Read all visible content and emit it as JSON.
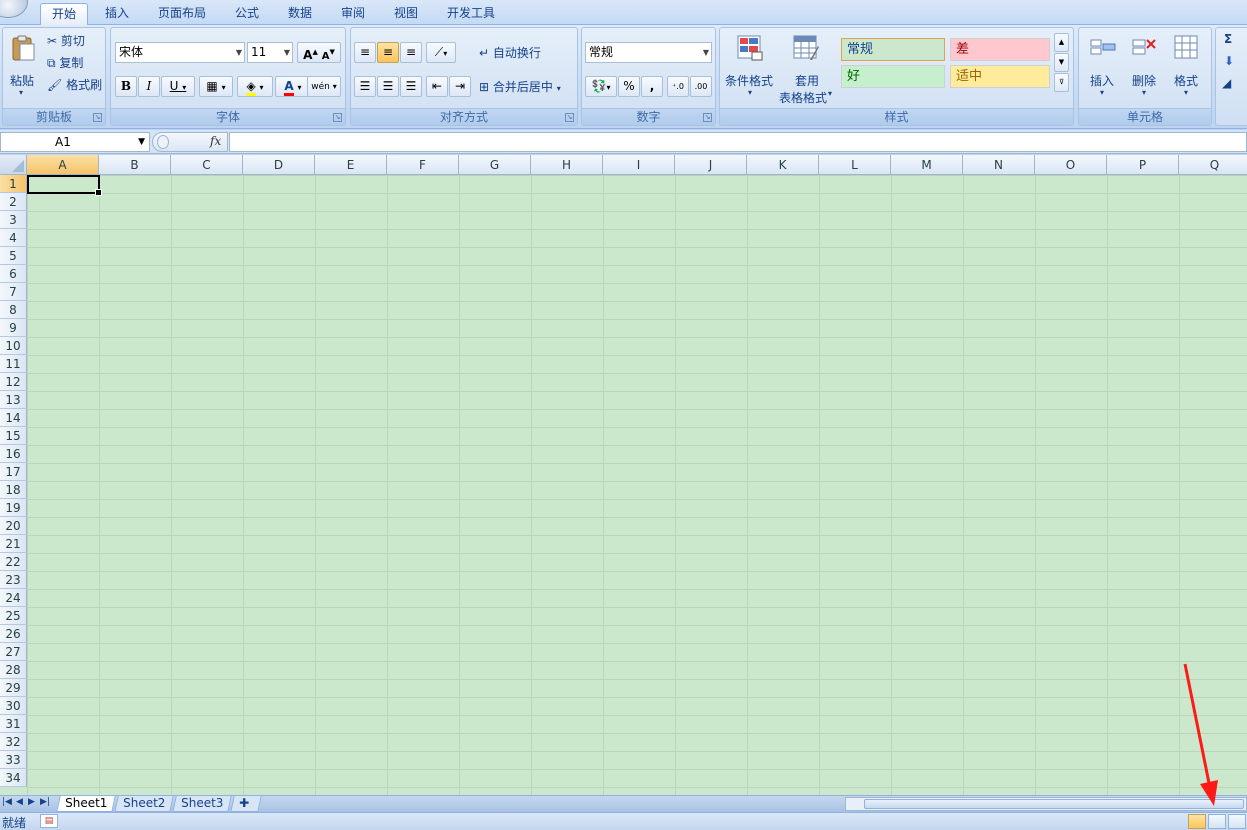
{
  "tabs": [
    "开始",
    "插入",
    "页面布局",
    "公式",
    "数据",
    "审阅",
    "视图",
    "开发工具"
  ],
  "clipboard": {
    "paste": "粘贴",
    "cut": "剪切",
    "copy": "复制",
    "format_painter": "格式刷",
    "label": "剪贴板"
  },
  "font": {
    "name": "宋体",
    "size": "11",
    "label": "字体",
    "bold": "B",
    "italic": "I",
    "underline": "U",
    "grow": "A",
    "shrink": "A",
    "color_letter": "A",
    "phonetic": "wén"
  },
  "alignment": {
    "wrap": "自动换行",
    "merge": "合并后居中",
    "label": "对齐方式"
  },
  "number": {
    "format": "常规",
    "percent": "%",
    "comma": ",",
    "label": "数字"
  },
  "styles": {
    "conditional": "条件格式",
    "table_line1": "套用",
    "table_line2": "表格格式",
    "normal": "常规",
    "bad": "差",
    "good": "好",
    "neutral": "适中",
    "label": "样式"
  },
  "cells_group": {
    "insert": "插入",
    "delete": "删除",
    "format": "格式",
    "label": "单元格"
  },
  "editing": {
    "sigma": "Σ"
  },
  "name_box": "A1",
  "fx": "fx",
  "columns": [
    "A",
    "B",
    "C",
    "D",
    "E",
    "F",
    "G",
    "H",
    "I",
    "J",
    "K",
    "L",
    "M",
    "N",
    "O",
    "P",
    "Q"
  ],
  "rows": [
    "1",
    "2",
    "3",
    "4",
    "5",
    "6",
    "7",
    "8",
    "9",
    "10",
    "11",
    "12",
    "13",
    "14",
    "15",
    "16",
    "17",
    "18",
    "19",
    "20",
    "21",
    "22",
    "23",
    "24",
    "25",
    "26",
    "27",
    "28",
    "29",
    "30",
    "31",
    "32",
    "33",
    "34"
  ],
  "sheets": [
    "Sheet1",
    "Sheet2",
    "Sheet3"
  ],
  "status": "就绪",
  "colors": {
    "grid_bg": "#cce8cc",
    "accent": "#15428b",
    "arrow": "#ff1a1a"
  }
}
